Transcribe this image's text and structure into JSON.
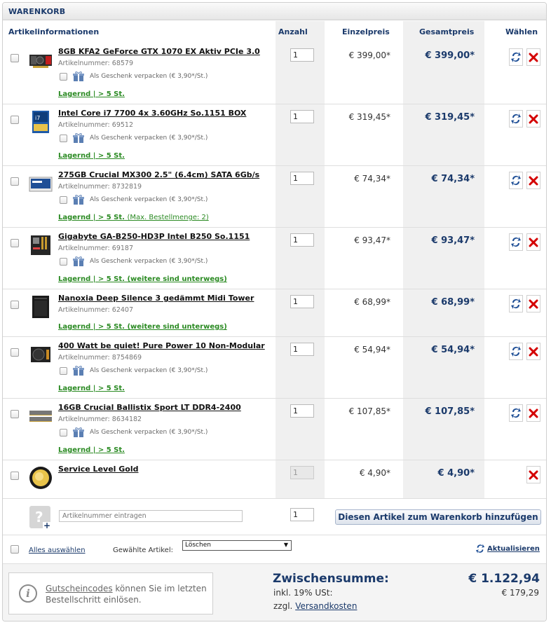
{
  "header": {
    "title": "WARENKORB"
  },
  "columns": {
    "info": "Artikelinformationen",
    "qty": "Anzahl",
    "unit": "Einzelpreis",
    "total": "Gesamtpreis",
    "select": "Wählen"
  },
  "gift_label": "Als Geschenk verpacken (€ 3,90*/St.)",
  "items": [
    {
      "name": "8GB KFA2 GeForce GTX 1070 EX Aktiv PCIe 3.0",
      "artnr": "Artikelnummer: 68579",
      "stock": "Lagernd | > 5 St.",
      "stock_note": "",
      "qty": "1",
      "unit": "€ 399,00*",
      "total": "€ 399,00*"
    },
    {
      "name": "Intel Core i7 7700 4x 3.60GHz So.1151 BOX",
      "artnr": "Artikelnummer: 69512",
      "stock": "Lagernd | > 5 St.",
      "stock_note": "",
      "qty": "1",
      "unit": "€ 319,45*",
      "total": "€ 319,45*"
    },
    {
      "name": "275GB Crucial MX300 2.5\" (6.4cm) SATA 6Gb/s",
      "artnr": "Artikelnummer: 8732819",
      "stock": "Lagernd | > 5 St.",
      "stock_note": "(Max. Bestellmenge: 2)",
      "qty": "1",
      "unit": "€ 74,34*",
      "total": "€ 74,34*"
    },
    {
      "name": "Gigabyte GA-B250-HD3P Intel B250 So.1151",
      "artnr": "Artikelnummer: 69187",
      "stock": "Lagernd | > 5 St. (weitere sind unterwegs)",
      "stock_note": "",
      "qty": "1",
      "unit": "€ 93,47*",
      "total": "€ 93,47*"
    },
    {
      "name": "Nanoxia Deep Silence 3 gedämmt Midi Tower",
      "artnr": "Artikelnummer: 62407",
      "stock": "Lagernd | > 5 St. (weitere sind unterwegs)",
      "stock_note": "",
      "qty": "1",
      "unit": "€ 68,99*",
      "total": "€ 68,99*"
    },
    {
      "name": "400 Watt be quiet! Pure Power 10 Non-Modular",
      "artnr": "Artikelnummer: 8754869",
      "stock": "Lagernd | > 5 St.",
      "stock_note": "",
      "qty": "1",
      "unit": "€ 54,94*",
      "total": "€ 54,94*"
    },
    {
      "name": "16GB Crucial Ballistix Sport LT DDR4-2400",
      "artnr": "Artikelnummer: 8634182",
      "stock": "Lagernd | > 5 St.",
      "stock_note": "",
      "qty": "1",
      "unit": "€ 107,85*",
      "total": "€ 107,85*"
    },
    {
      "name": "Service Level Gold",
      "qty": "1",
      "unit": "€ 4,90*",
      "total": "€ 4,90*"
    }
  ],
  "add_row": {
    "placeholder": "Artikelnummer eintragen",
    "qty": "1",
    "button": "Diesen Artikel zum Warenkorb hinzufügen"
  },
  "bulk": {
    "select_all": "Alles auswählen",
    "selected_label": "Gewählte Artikel:",
    "action": "Löschen",
    "refresh": "Aktualisieren"
  },
  "footer": {
    "voucher_link": "Gutscheincodes",
    "voucher_text": " können Sie im letzten Bestellschritt einlösen.",
    "subtotal_label": "Zwischensumme:",
    "subtotal": "€ 1.122,94",
    "vat_label": "inkl. 19% USt:",
    "vat": "€ 179,29",
    "shipping_prefix": "zzgl. ",
    "shipping_link": "Versandkosten"
  },
  "colors": {
    "accent": "#1b3a6b",
    "stock": "#2a8a22",
    "delete": "#d40000"
  }
}
